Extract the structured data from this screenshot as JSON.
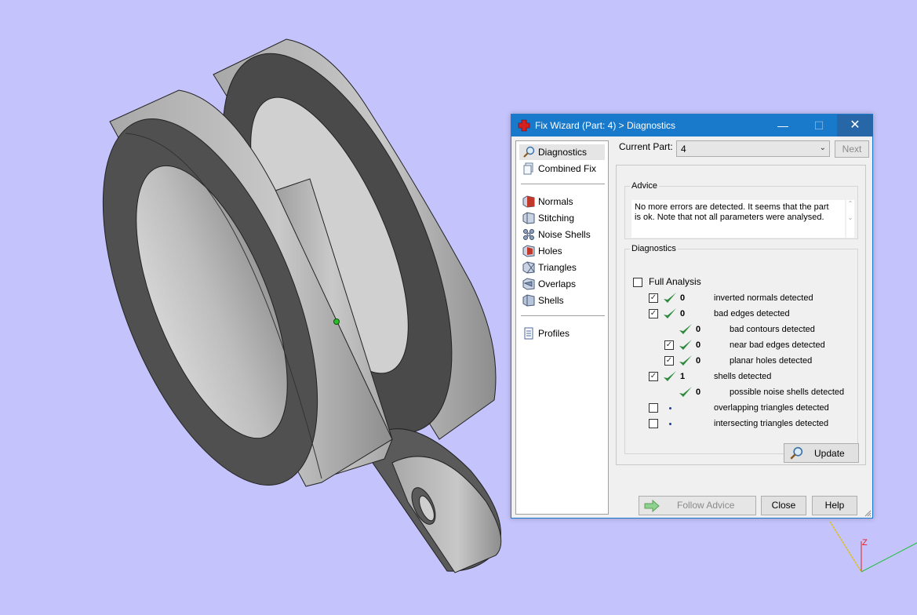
{
  "window": {
    "title": "Fix Wizard (Part: 4) > Diagnostics"
  },
  "nav": {
    "items": [
      {
        "label": "Diagnostics",
        "icon": "magnifier-icon",
        "selected": true
      },
      {
        "label": "Combined Fix",
        "icon": "combined-fix-icon"
      },
      {
        "label": "Normals",
        "icon": "normals-icon"
      },
      {
        "label": "Stitching",
        "icon": "stitching-icon"
      },
      {
        "label": "Noise Shells",
        "icon": "noise-shells-icon"
      },
      {
        "label": "Holes",
        "icon": "holes-icon"
      },
      {
        "label": "Triangles",
        "icon": "triangles-icon"
      },
      {
        "label": "Overlaps",
        "icon": "overlaps-icon"
      },
      {
        "label": "Shells",
        "icon": "shells-icon"
      },
      {
        "label": "Profiles",
        "icon": "document-icon"
      }
    ]
  },
  "part_selector": {
    "label": "Current Part:",
    "value": "4",
    "next_label": "Next"
  },
  "advice": {
    "title": "Advice",
    "text": "No more errors are detected. It seems that the part is ok. Note that not all parameters were analysed."
  },
  "diagnostics": {
    "title": "Diagnostics",
    "full_analysis_label": "Full Analysis",
    "full_analysis_checked": false,
    "rows": [
      {
        "label": "inverted normals detected",
        "count": "0",
        "checked": true,
        "status": "ok",
        "has_checkbox": true
      },
      {
        "label": "bad edges detected",
        "count": "0",
        "checked": true,
        "status": "ok",
        "has_checkbox": true
      },
      {
        "label": "bad contours detected",
        "count": "0",
        "status": "ok",
        "has_checkbox": false
      },
      {
        "label": "near bad edges detected",
        "count": "0",
        "checked": true,
        "status": "ok",
        "has_checkbox": true
      },
      {
        "label": "planar holes detected",
        "count": "0",
        "checked": true,
        "status": "ok",
        "has_checkbox": true
      },
      {
        "label": "shells detected",
        "count": "1",
        "checked": true,
        "status": "ok",
        "has_checkbox": true
      },
      {
        "label": "possible noise shells detected",
        "count": "0",
        "status": "ok",
        "has_checkbox": false
      },
      {
        "label": "overlapping triangles detected",
        "count": "",
        "checked": false,
        "status": "pending",
        "has_checkbox": true
      },
      {
        "label": "intersecting triangles detected",
        "count": "",
        "checked": false,
        "status": "pending",
        "has_checkbox": true
      }
    ],
    "update_label": "Update"
  },
  "buttons": {
    "follow_advice": "Follow Advice",
    "close": "Close",
    "help": "Help"
  },
  "axis": {
    "z_label": "Z"
  },
  "colors": {
    "viewport_background": "#c4c3fb",
    "titlebar": "#1979ca",
    "check_green": "#2e8b3e",
    "part_gray": "#8c8c8c"
  }
}
